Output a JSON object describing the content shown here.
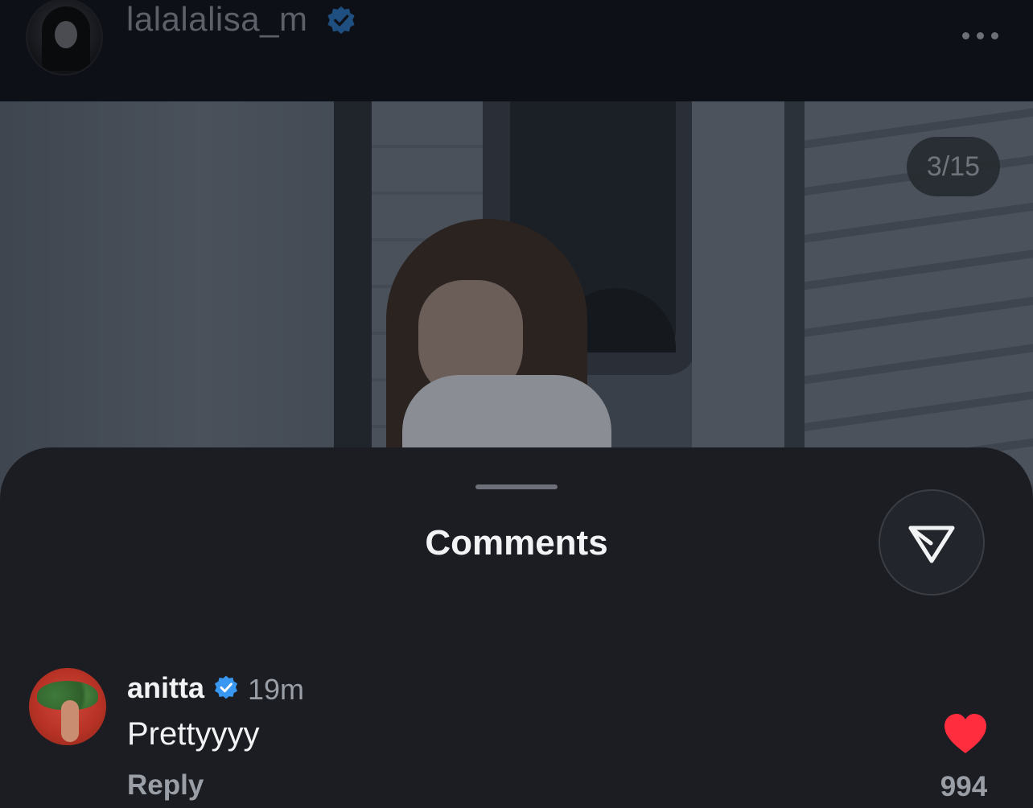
{
  "post": {
    "username": "lalalalisa_m",
    "verified": true,
    "subtitle_blurred": "",
    "more_icon": "more-horizontal-icon",
    "slide_counter": "3/15"
  },
  "comments_sheet": {
    "title": "Comments",
    "share_icon": "send-icon",
    "comments": [
      {
        "username": "anitta",
        "verified": true,
        "time": "19m",
        "text": "Prettyyyy",
        "reply_label": "Reply",
        "liked": true,
        "like_count": "994"
      }
    ]
  },
  "colors": {
    "verified_badge": "#3897f0",
    "like_heart": "#ff2d3d",
    "sheet_background": "#1b1d22"
  }
}
